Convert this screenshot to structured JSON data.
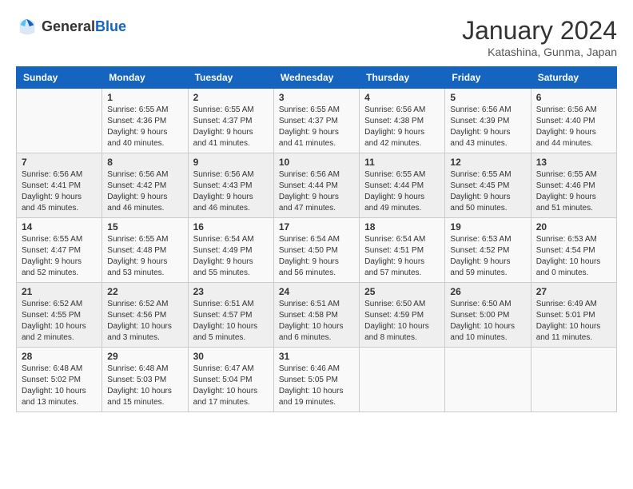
{
  "logo": {
    "line1": "General",
    "line2": "Blue"
  },
  "title": "January 2024",
  "subtitle": "Katashina, Gunma, Japan",
  "days_of_week": [
    "Sunday",
    "Monday",
    "Tuesday",
    "Wednesday",
    "Thursday",
    "Friday",
    "Saturday"
  ],
  "weeks": [
    [
      {
        "day": "",
        "sunrise": "",
        "sunset": "",
        "daylight": ""
      },
      {
        "day": "1",
        "sunrise": "Sunrise: 6:55 AM",
        "sunset": "Sunset: 4:36 PM",
        "daylight": "Daylight: 9 hours and 40 minutes."
      },
      {
        "day": "2",
        "sunrise": "Sunrise: 6:55 AM",
        "sunset": "Sunset: 4:37 PM",
        "daylight": "Daylight: 9 hours and 41 minutes."
      },
      {
        "day": "3",
        "sunrise": "Sunrise: 6:55 AM",
        "sunset": "Sunset: 4:37 PM",
        "daylight": "Daylight: 9 hours and 41 minutes."
      },
      {
        "day": "4",
        "sunrise": "Sunrise: 6:56 AM",
        "sunset": "Sunset: 4:38 PM",
        "daylight": "Daylight: 9 hours and 42 minutes."
      },
      {
        "day": "5",
        "sunrise": "Sunrise: 6:56 AM",
        "sunset": "Sunset: 4:39 PM",
        "daylight": "Daylight: 9 hours and 43 minutes."
      },
      {
        "day": "6",
        "sunrise": "Sunrise: 6:56 AM",
        "sunset": "Sunset: 4:40 PM",
        "daylight": "Daylight: 9 hours and 44 minutes."
      }
    ],
    [
      {
        "day": "7",
        "sunrise": "Sunrise: 6:56 AM",
        "sunset": "Sunset: 4:41 PM",
        "daylight": "Daylight: 9 hours and 45 minutes."
      },
      {
        "day": "8",
        "sunrise": "Sunrise: 6:56 AM",
        "sunset": "Sunset: 4:42 PM",
        "daylight": "Daylight: 9 hours and 46 minutes."
      },
      {
        "day": "9",
        "sunrise": "Sunrise: 6:56 AM",
        "sunset": "Sunset: 4:43 PM",
        "daylight": "Daylight: 9 hours and 46 minutes."
      },
      {
        "day": "10",
        "sunrise": "Sunrise: 6:56 AM",
        "sunset": "Sunset: 4:44 PM",
        "daylight": "Daylight: 9 hours and 47 minutes."
      },
      {
        "day": "11",
        "sunrise": "Sunrise: 6:55 AM",
        "sunset": "Sunset: 4:44 PM",
        "daylight": "Daylight: 9 hours and 49 minutes."
      },
      {
        "day": "12",
        "sunrise": "Sunrise: 6:55 AM",
        "sunset": "Sunset: 4:45 PM",
        "daylight": "Daylight: 9 hours and 50 minutes."
      },
      {
        "day": "13",
        "sunrise": "Sunrise: 6:55 AM",
        "sunset": "Sunset: 4:46 PM",
        "daylight": "Daylight: 9 hours and 51 minutes."
      }
    ],
    [
      {
        "day": "14",
        "sunrise": "Sunrise: 6:55 AM",
        "sunset": "Sunset: 4:47 PM",
        "daylight": "Daylight: 9 hours and 52 minutes."
      },
      {
        "day": "15",
        "sunrise": "Sunrise: 6:55 AM",
        "sunset": "Sunset: 4:48 PM",
        "daylight": "Daylight: 9 hours and 53 minutes."
      },
      {
        "day": "16",
        "sunrise": "Sunrise: 6:54 AM",
        "sunset": "Sunset: 4:49 PM",
        "daylight": "Daylight: 9 hours and 55 minutes."
      },
      {
        "day": "17",
        "sunrise": "Sunrise: 6:54 AM",
        "sunset": "Sunset: 4:50 PM",
        "daylight": "Daylight: 9 hours and 56 minutes."
      },
      {
        "day": "18",
        "sunrise": "Sunrise: 6:54 AM",
        "sunset": "Sunset: 4:51 PM",
        "daylight": "Daylight: 9 hours and 57 minutes."
      },
      {
        "day": "19",
        "sunrise": "Sunrise: 6:53 AM",
        "sunset": "Sunset: 4:52 PM",
        "daylight": "Daylight: 9 hours and 59 minutes."
      },
      {
        "day": "20",
        "sunrise": "Sunrise: 6:53 AM",
        "sunset": "Sunset: 4:54 PM",
        "daylight": "Daylight: 10 hours and 0 minutes."
      }
    ],
    [
      {
        "day": "21",
        "sunrise": "Sunrise: 6:52 AM",
        "sunset": "Sunset: 4:55 PM",
        "daylight": "Daylight: 10 hours and 2 minutes."
      },
      {
        "day": "22",
        "sunrise": "Sunrise: 6:52 AM",
        "sunset": "Sunset: 4:56 PM",
        "daylight": "Daylight: 10 hours and 3 minutes."
      },
      {
        "day": "23",
        "sunrise": "Sunrise: 6:51 AM",
        "sunset": "Sunset: 4:57 PM",
        "daylight": "Daylight: 10 hours and 5 minutes."
      },
      {
        "day": "24",
        "sunrise": "Sunrise: 6:51 AM",
        "sunset": "Sunset: 4:58 PM",
        "daylight": "Daylight: 10 hours and 6 minutes."
      },
      {
        "day": "25",
        "sunrise": "Sunrise: 6:50 AM",
        "sunset": "Sunset: 4:59 PM",
        "daylight": "Daylight: 10 hours and 8 minutes."
      },
      {
        "day": "26",
        "sunrise": "Sunrise: 6:50 AM",
        "sunset": "Sunset: 5:00 PM",
        "daylight": "Daylight: 10 hours and 10 minutes."
      },
      {
        "day": "27",
        "sunrise": "Sunrise: 6:49 AM",
        "sunset": "Sunset: 5:01 PM",
        "daylight": "Daylight: 10 hours and 11 minutes."
      }
    ],
    [
      {
        "day": "28",
        "sunrise": "Sunrise: 6:48 AM",
        "sunset": "Sunset: 5:02 PM",
        "daylight": "Daylight: 10 hours and 13 minutes."
      },
      {
        "day": "29",
        "sunrise": "Sunrise: 6:48 AM",
        "sunset": "Sunset: 5:03 PM",
        "daylight": "Daylight: 10 hours and 15 minutes."
      },
      {
        "day": "30",
        "sunrise": "Sunrise: 6:47 AM",
        "sunset": "Sunset: 5:04 PM",
        "daylight": "Daylight: 10 hours and 17 minutes."
      },
      {
        "day": "31",
        "sunrise": "Sunrise: 6:46 AM",
        "sunset": "Sunset: 5:05 PM",
        "daylight": "Daylight: 10 hours and 19 minutes."
      },
      {
        "day": "",
        "sunrise": "",
        "sunset": "",
        "daylight": ""
      },
      {
        "day": "",
        "sunrise": "",
        "sunset": "",
        "daylight": ""
      },
      {
        "day": "",
        "sunrise": "",
        "sunset": "",
        "daylight": ""
      }
    ]
  ]
}
